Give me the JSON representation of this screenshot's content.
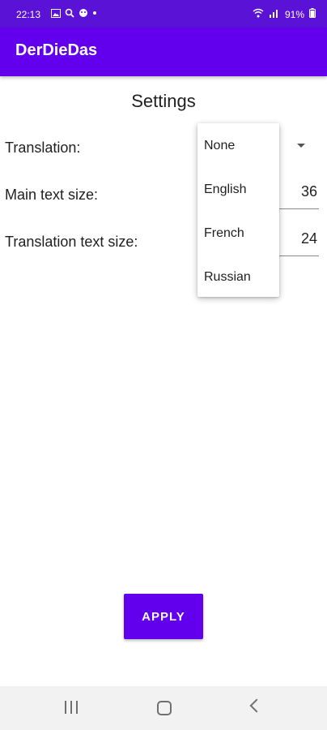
{
  "status_bar": {
    "time": "22:13",
    "left_icons": [
      "image-icon",
      "search-icon",
      "face-icon",
      "dot-icon"
    ],
    "battery": "91%",
    "right_icons": [
      "wifi-icon",
      "signal-icon",
      "battery-icon"
    ]
  },
  "app_bar": {
    "title": "DerDieDas"
  },
  "settings": {
    "title": "Settings",
    "translation_label": "Translation:",
    "main_text_size_label": "Main text size:",
    "main_text_size_value": "36",
    "translation_text_size_label": "Translation text size:",
    "translation_text_size_value": "24"
  },
  "translation_menu": {
    "options": [
      "None",
      "English",
      "French",
      "Russian"
    ]
  },
  "apply_button": {
    "label": "APPLY"
  },
  "nav_bar": {
    "icons": [
      "recent-apps-icon",
      "home-icon",
      "back-icon"
    ]
  },
  "colors": {
    "primary": "#6200ee",
    "status_bar": "#5a13d6"
  }
}
